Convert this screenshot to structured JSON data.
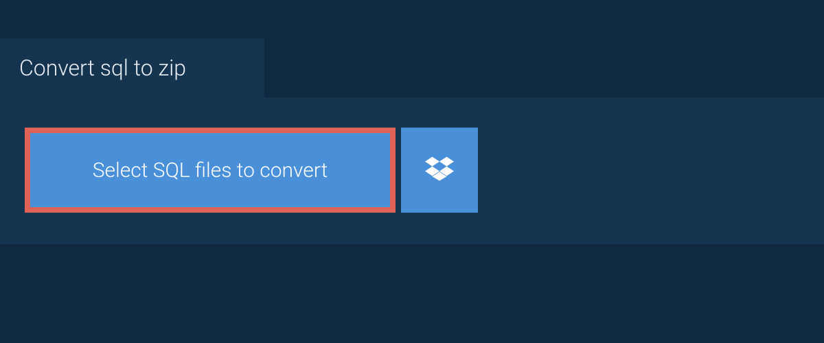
{
  "tab": {
    "title": "Convert sql to zip"
  },
  "upload": {
    "select_label": "Select SQL files to convert",
    "dropbox_icon": "dropbox-icon"
  },
  "colors": {
    "bg": "#0f2940",
    "panel": "#15344f",
    "button": "#4a90d9",
    "highlight_border": "#e06257",
    "text_light": "#e8edf2",
    "text_white": "#ffffff"
  }
}
